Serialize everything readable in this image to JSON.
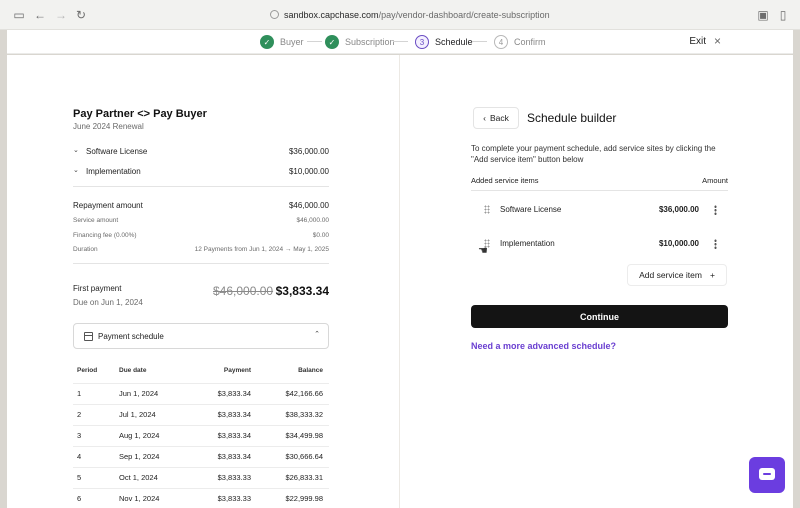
{
  "browser": {
    "url_domain": "sandbox.capchase.com",
    "url_path": "/pay/vendor-dashboard/create-subscription",
    "icons": [
      "sidebar-icon",
      "back-arrow-icon",
      "forward-arrow-icon",
      "reload-icon",
      "lock-icon",
      "extension-icon",
      "split-view-icon"
    ]
  },
  "stepper": {
    "steps": [
      {
        "label": "Buyer",
        "state": "done",
        "marker": "✓"
      },
      {
        "label": "Subscription",
        "state": "done",
        "marker": "✓"
      },
      {
        "label": "Schedule",
        "state": "active",
        "marker": "3"
      },
      {
        "label": "Confirm",
        "state": "pending",
        "marker": "4"
      }
    ],
    "exit_label": "Exit",
    "exit_icon": "×"
  },
  "summary": {
    "title": "Pay Partner <> Pay Buyer",
    "subtitle": "June 2024 Renewal",
    "line_items": [
      {
        "name": "Software License",
        "amount": "$36,000.00"
      },
      {
        "name": "Implementation",
        "amount": "$10,000.00"
      }
    ],
    "repayment_label": "Repayment amount",
    "repayment_value": "$46,000.00",
    "service_amount_label": "Service amount",
    "service_amount_value": "$46,000.00",
    "financing_fee_label": "Financing fee (0.00%)",
    "financing_fee_value": "$0.00",
    "duration_label": "Duration",
    "duration_value": "12 Payments from Jun 1, 2024 → May 1, 2025",
    "first_payment_label": "First payment",
    "first_payment_due": "Due on Jun 1, 2024",
    "first_payment_old": "$46,000.00",
    "first_payment_new": "$3,833.34",
    "schedule_toggle_label": "Payment schedule",
    "table": {
      "headers": [
        "Period",
        "Due date",
        "Payment",
        "Balance"
      ],
      "rows": [
        [
          "1",
          "Jun 1, 2024",
          "$3,833.34",
          "$42,166.66"
        ],
        [
          "2",
          "Jul 1, 2024",
          "$3,833.34",
          "$38,333.32"
        ],
        [
          "3",
          "Aug 1, 2024",
          "$3,833.34",
          "$34,499.98"
        ],
        [
          "4",
          "Sep 1, 2024",
          "$3,833.34",
          "$30,666.64"
        ],
        [
          "5",
          "Oct 1, 2024",
          "$3,833.33",
          "$26,833.31"
        ],
        [
          "6",
          "Nov 1, 2024",
          "$3,833.33",
          "$22,999.98"
        ]
      ]
    }
  },
  "builder": {
    "back_label": "Back",
    "title": "Schedule builder",
    "description_line1": "To complete your payment schedule, add service sites by clicking the",
    "description_line2": "\"Add service item\" button below",
    "items_header": "Added service items",
    "amount_header": "Amount",
    "items": [
      {
        "name": "Software License",
        "amount": "$36,000.00"
      },
      {
        "name": "Implementation",
        "amount": "$10,000.00"
      }
    ],
    "add_label": "Add service item",
    "add_icon": "+",
    "continue_label": "Continue",
    "advanced_link": "Need a more advanced schedule?"
  },
  "colors": {
    "accent": "#6b3de0",
    "success": "#2f8f5b",
    "primary_button": "#141414"
  }
}
